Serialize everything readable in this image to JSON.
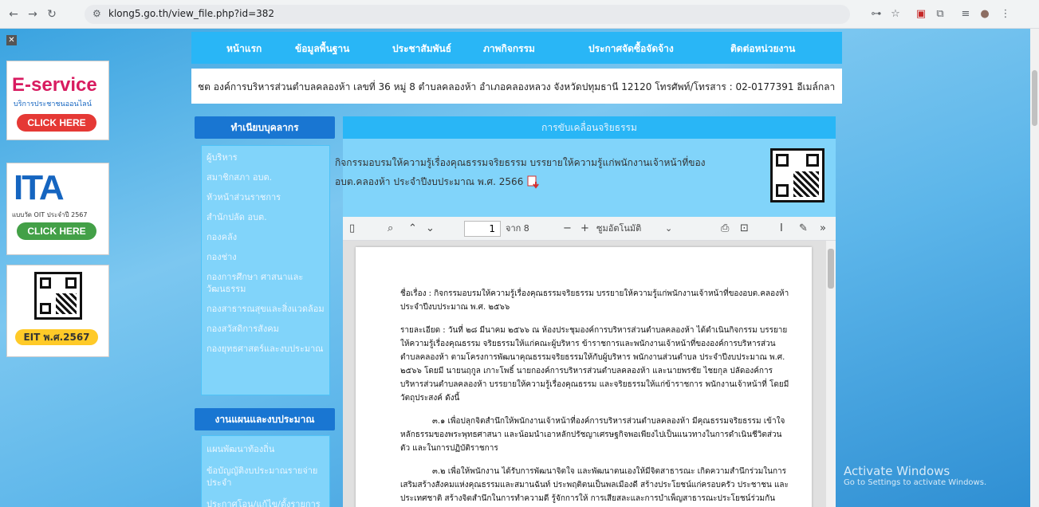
{
  "browser": {
    "url": "klong5.go.th/view_file.php?id=382"
  },
  "banners": {
    "eservice_title": "E-service",
    "eservice_sub": "บริการประชาชนออนไลน์",
    "eservice_click": "CLICK HERE",
    "ita_logo": "ITA",
    "ita_sub": "แบบวัด OIT ประจำปี 2567",
    "ita_click": "CLICK HERE",
    "eit_button": "EIT พ.ศ.2567"
  },
  "topnav": {
    "items": [
      "หน้าแรก",
      "ข้อมูลพื้นฐาน",
      "ประชาสัมพันธ์",
      "ภาพกิจกรรม",
      "ประกาศจัดซื้อจัดจ้าง",
      "ติดต่อหน่วยงาน"
    ]
  },
  "address": "ชต องค์การบริหารส่วนตำบลคลองห้า เลขที่ 36 หมู่ 8 ตำบลคลองห้า อำเภอคลองหลวง จังหวัดปทุมธานี 12120 โทรศัพท์/โทรสาร : 02-0177391 อีเมล์กลา",
  "sidebar": {
    "section1_title": "ทำเนียบบุคลากร",
    "section1_items": [
      "ผู้บริหาร",
      "สมาชิกสภา อบต.",
      "หัวหน้าส่วนราชการ",
      "สำนักปลัด อบต.",
      "กองคลัง",
      "กองช่าง",
      "กองการศึกษา ศาสนาและวัฒนธรรม",
      "กองสาธารณสุขและสิ่งแวดล้อม",
      "กองสวัสดิการสังคม",
      "กองยุทธศาสตร์และงบประมาณ"
    ],
    "section2_title": "งานแผนและงบประมาณ",
    "section2_items": [
      "แผนพัฒนาท้องถิ่น",
      "ข้อบัญญัติงบประมาณรายจ่ายประจำ",
      "ประกาศโอน/แก้ไข/ตั้งรายการ"
    ]
  },
  "content": {
    "header": "การขับเคลื่อนจริยธรรม",
    "description": "กิจกรรมอบรมให้ความรู้เรื่องคุณธรรมจริยธรรม บรรยายให้ความรู้แก่พนักงานเจ้าหน้าที่ของ อบต.คลองห้า ประจำปีงบประมาณ พ.ศ. 2566"
  },
  "pdf_toolbar": {
    "page_current": "1",
    "page_total": "จาก 8",
    "zoom": "ซูมอัตโนมัติ"
  },
  "pdf_doc": {
    "title": "ชื่อเรื่อง : กิจกรรมอบรมให้ความรู้เรื่องคุณธรรมจริยธรรม บรรยายให้ความรู้แก่พนักงานเจ้าหน้าที่ของอบต.คลองห้า ประจำปีงบประมาณ พ.ศ. ๒๕๖๖",
    "detail": "รายละเอียด : วันที่ ๒๘ มีนาคม ๒๕๖๖ ณ ห้องประชุมองค์การบริหารส่วนตำบลคลองห้า ได้ดำเนินกิจกรรม บรรยายให้ความรู้เรื่องคุณธรรม จริยธรรมให้แก่คณะผู้บริหาร ข้าราชการและพนักงานเจ้าหน้าที่ขององค์การบริหารส่วนตำบลคลองห้า ตามโครงการพัฒนาคุณธรรมจริยธรรมให้กับผู้บริหาร พนักงานส่วนตำบล ประจำปีงบประมาณ พ.ศ. ๒๕๖๖ โดยมี นายนฤกูล เกาะโพธิ์ นายกองค์การบริหารส่วนตำบลคลองห้า และนายพรชัย ไชยกุล ปลัดองค์การบริหารส่วนตำบลคลองห้า บรรยายให้ความรู้เรื่องคุณธรรม และจริยธรรมให้แก่ข้าราชการ พนักงานเจ้าหน้าที่ โดยมีวัตถุประสงค์ ดังนี้",
    "item1": "๓.๑ เพื่อปลุกจิตสำนึกให้พนักงานเจ้าหน้าที่องค์การบริหารส่วนตำบลคลองห้า มีคุณธรรมจริยธรรม เข้าใจหลักธรรมของพระพุทธศาสนา และน้อมนำเอาหลักปรัชญาเศรษฐกิจพอเพียงไปเป็นแนวทางในการดำเนินชีวิตส่วนตัว และในการปฏิบัติราชการ",
    "item2": "๓.๒ เพื่อให้พนักงาน ได้รับการพัฒนาจิตใจ และพัฒนาตนเองให้มีจิตสาธารณะ เกิดความสำนึกร่วมในการเสริมสร้างสังคมแห่งคุณธรรมและสมานฉันท์ ประพฤติตนเป็นพลเมืองดี สร้างประโยชน์แก่ครอบครัว ประชาชน และประเทศชาติ สร้างจิตสำนึกในการทำความดี รู้จักการให้ การเสียสละและการบำเพ็ญสาธารณะประโยชน์ร่วมกัน"
  },
  "watermark": {
    "line1": "Activate Windows",
    "line2": "Go to Settings to activate Windows."
  }
}
